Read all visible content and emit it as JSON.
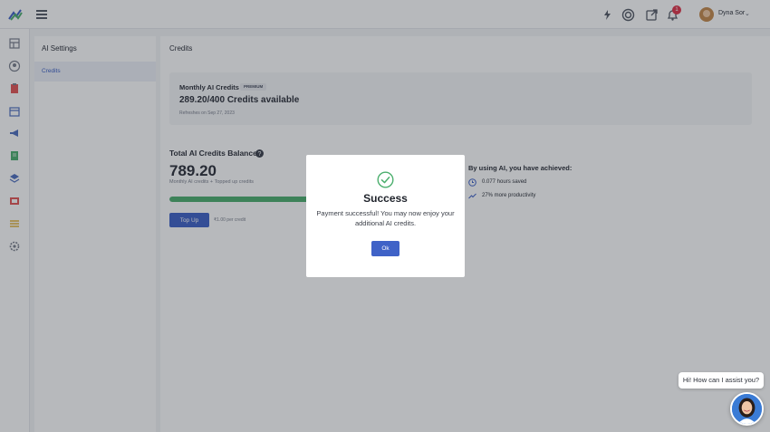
{
  "header": {
    "user_name": "Dyna Sor",
    "notification_count": "1",
    "icons": [
      "logo-icon",
      "menu-icon",
      "flash-icon",
      "target-icon",
      "external-link-icon",
      "bell-icon",
      "avatar",
      "chevron-down-icon"
    ]
  },
  "rail": {
    "icons": [
      "dashboard-icon",
      "user-icon",
      "clipboard-icon",
      "calendar-icon",
      "megaphone-icon",
      "document-icon",
      "layers-icon",
      "folder-icon",
      "table-icon",
      "gear-icon"
    ]
  },
  "settings_panel": {
    "title": "AI Settings",
    "items": [
      {
        "label": "Credits",
        "active": true
      }
    ]
  },
  "main": {
    "title": "Credits",
    "monthly": {
      "label": "Monthly AI Credits",
      "badge": "PREMIUM",
      "available": "289.20/400 Credits available",
      "refreshed": "Refreshes on Sep 27, 2023"
    },
    "balance": {
      "title": "Total AI Credits Balance",
      "value": "789.20",
      "subtitle": "Monthly AI credits + Topped up credits",
      "progress_fraction": 0.72,
      "topup_label": "Top Up",
      "price_note": "₹1.00 per credit"
    },
    "achievements": {
      "title": "By using AI, you have achieved:",
      "items": [
        {
          "icon": "clock-icon",
          "text": "0.077 hours saved"
        },
        {
          "icon": "trending-up-icon",
          "text": "27% more productivity"
        }
      ]
    }
  },
  "modal": {
    "icon": "check-circle-icon",
    "title": "Success",
    "message": "Payment successful! You may now enjoy your additional AI credits.",
    "ok_label": "Ok"
  },
  "chat": {
    "greeting": "Hi! How can I assist you?"
  },
  "colors": {
    "accent": "#3f62c7",
    "success": "#4caf6e",
    "badge": "#e0344a"
  }
}
